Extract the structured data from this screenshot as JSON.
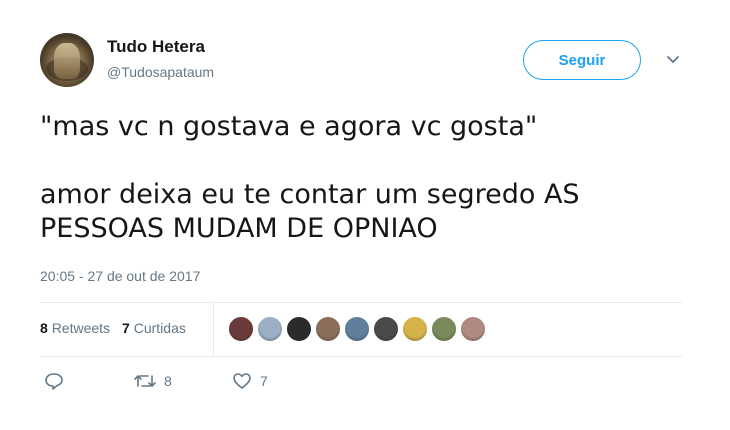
{
  "tweet": {
    "author_name": "Tudo Hetera",
    "author_handle": "@Tudosapataum",
    "follow_label": "Seguir",
    "text": "\"mas vc n gostava e agora vc gosta\"\n\namor deixa eu te contar um segredo AS PESSOAS MUDAM DE OPNIAO",
    "timestamp": "20:05 - 27 de out de 2017"
  },
  "stats": {
    "retweets_count": "8",
    "retweets_label": "Retweets",
    "likes_count": "7",
    "likes_label": "Curtidas"
  },
  "actions": {
    "reply_icon": "reply-icon",
    "retweet_count": "8",
    "like_count": "7"
  },
  "colors": {
    "accent": "#1da1f2",
    "text": "#14171a",
    "muted": "#657786",
    "divider": "#e6ecf0"
  },
  "liker_avatars": [
    {
      "color": "#6b3a3a"
    },
    {
      "color": "#9bb0c4"
    },
    {
      "color": "#2b2b2b"
    },
    {
      "color": "#8a6e5a"
    },
    {
      "color": "#5f7f9c"
    },
    {
      "color": "#4a4a4a"
    },
    {
      "color": "#d6b24a"
    },
    {
      "color": "#7a8a5a"
    },
    {
      "color": "#b08a80"
    }
  ]
}
